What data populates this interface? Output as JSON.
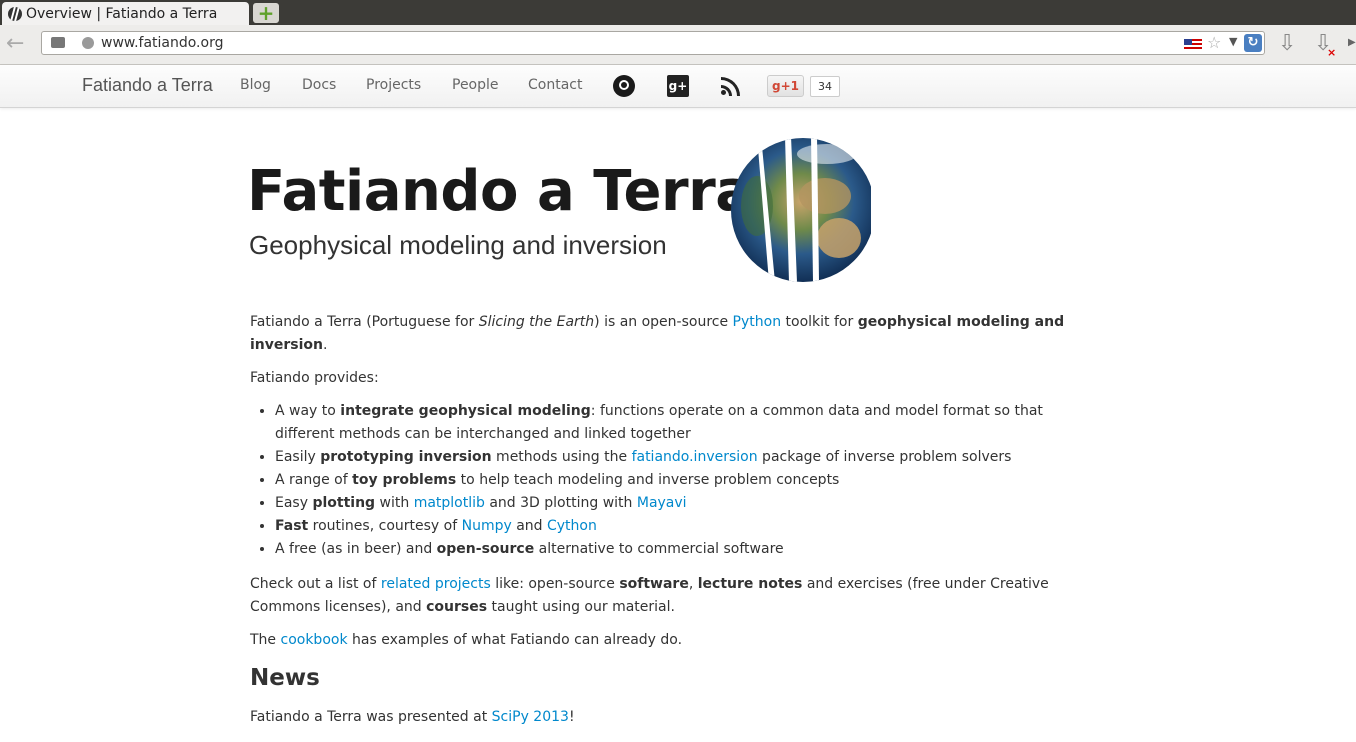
{
  "browser": {
    "tab_title": "Overview | Fatiando a Terra",
    "new_tab_label": "+",
    "url": "www.fatiando.org"
  },
  "site_nav": {
    "brand": "Fatiando a Terra",
    "links": [
      "Blog",
      "Docs",
      "Projects",
      "People",
      "Contact"
    ],
    "gplus_label": "+1",
    "gplus_count": "34",
    "google_glyph": "g+"
  },
  "hero": {
    "title": "Fatiando a Terra",
    "subtitle": "Geophysical modeling and inversion"
  },
  "intro": {
    "t1": "Fatiando a Terra (Portuguese for ",
    "em": "Slicing the Earth",
    "t2": ") is an open-source ",
    "python": "Python",
    "t3": " toolkit for ",
    "strong": "geophysical modeling and inversion",
    "t4": "."
  },
  "provides_label": "Fatiando provides:",
  "bullets": {
    "b1": {
      "t1": "A way to ",
      "strong": "integrate geophysical modeling",
      "t2": ": functions operate on a common data and model format so that different methods can be interchanged and linked together"
    },
    "b2": {
      "t1": "Easily ",
      "strong": "prototyping inversion",
      "t2": " methods using the ",
      "link": "fatiando.inversion",
      "t3": " package of inverse problem solvers"
    },
    "b3": {
      "t1": "A range of ",
      "strong": "toy problems",
      "t2": " to help teach modeling and inverse problem concepts"
    },
    "b4": {
      "t1": "Easy ",
      "strong": "plotting",
      "t2": " with ",
      "link1": "matplotlib",
      "t3": " and 3D plotting with ",
      "link2": "Mayavi"
    },
    "b5": {
      "strong": "Fast",
      "t1": " routines, courtesy of ",
      "link1": "Numpy",
      "t2": " and ",
      "link2": "Cython"
    },
    "b6": {
      "t1": "A free (as in beer) and ",
      "strong": "open-source",
      "t2": " alternative to commercial software"
    }
  },
  "related": {
    "t1": "Check out a list of ",
    "link": "related projects",
    "t2": " like: open-source ",
    "s1": "software",
    "t3": ", ",
    "s2": "lecture notes",
    "t4": " and exercises (free under Creative Commons licenses), and ",
    "s3": "courses",
    "t5": " taught using our material."
  },
  "cookbook": {
    "t1": "The ",
    "link": "cookbook",
    "t2": " has examples of what Fatiando can already do."
  },
  "news": {
    "heading": "News",
    "t1": "Fatiando a Terra was presented at ",
    "link": "SciPy 2013",
    "t2": "!"
  },
  "colors": {
    "link": "#0088cc",
    "text": "#333333",
    "chrome_dark": "#3c3b37"
  },
  "icons": [
    "github-icon",
    "google-plus-icon",
    "rss-icon",
    "earth-logo"
  ]
}
